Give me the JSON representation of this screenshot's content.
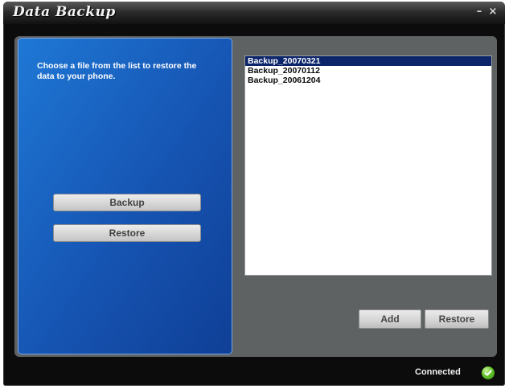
{
  "window": {
    "title": "Data Backup",
    "minimize_glyph": "–",
    "close_glyph": "×"
  },
  "left_panel": {
    "instruction": "Choose a file from the list to restore the data to your phone.",
    "backup_label": "Backup",
    "restore_label": "Restore"
  },
  "file_list": {
    "items": [
      "Backup_20070321",
      "Backup_20070112",
      "Backup_20061204"
    ],
    "selected_index": 0
  },
  "actions": {
    "add_label": "Add",
    "restore_label": "Restore"
  },
  "status": {
    "text": "Connected",
    "icon": "check-icon",
    "color": "#55b52a"
  },
  "colors": {
    "panel_blue": "#1654b2",
    "selection": "#0b246a"
  }
}
